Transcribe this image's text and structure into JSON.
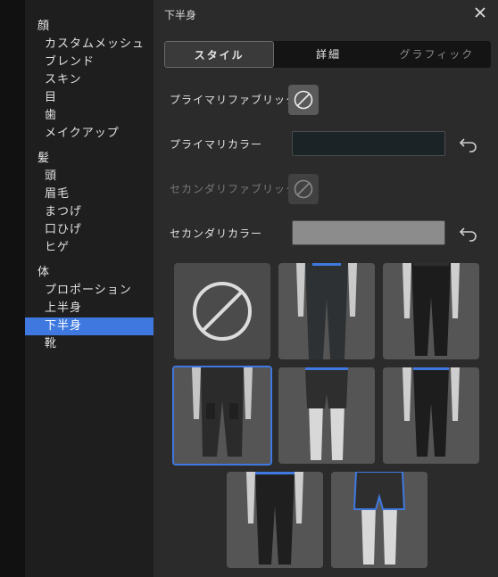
{
  "sidebar": {
    "groups": [
      {
        "title": "顔",
        "items": [
          "カスタムメッシュ",
          "ブレンド",
          "スキン",
          "目",
          "歯",
          "メイクアップ"
        ]
      },
      {
        "title": "髪",
        "items": [
          "頭",
          "眉毛",
          "まつげ",
          "口ひげ",
          "ヒゲ"
        ]
      },
      {
        "title": "体",
        "items": [
          "プロポーション",
          "上半身",
          "下半身",
          "靴"
        ]
      }
    ],
    "active_item": "下半身"
  },
  "panel": {
    "title": "下半身",
    "tabs": [
      "スタイル",
      "詳細",
      "グラフィック"
    ],
    "active_tab": "スタイル",
    "primary_fabric_label": "プライマリファブリック",
    "primary_color_label": "プライマリカラー",
    "secondary_fabric_label": "セカンダリファブリック",
    "secondary_color_label": "セカンダリカラー",
    "primary_color": "#1c2327",
    "secondary_color": "#8c8c8c"
  },
  "thumbnails": [
    {
      "name": "none",
      "selected": false
    },
    {
      "name": "pants-dark-fitted",
      "selected": false
    },
    {
      "name": "leggings-black",
      "selected": false
    },
    {
      "name": "cargo-joggers",
      "selected": true
    },
    {
      "name": "boxer-shorts",
      "selected": false
    },
    {
      "name": "compression-tights",
      "selected": false
    },
    {
      "name": "slim-pants-black",
      "selected": false
    },
    {
      "name": "athletic-shorts",
      "selected": false
    }
  ]
}
